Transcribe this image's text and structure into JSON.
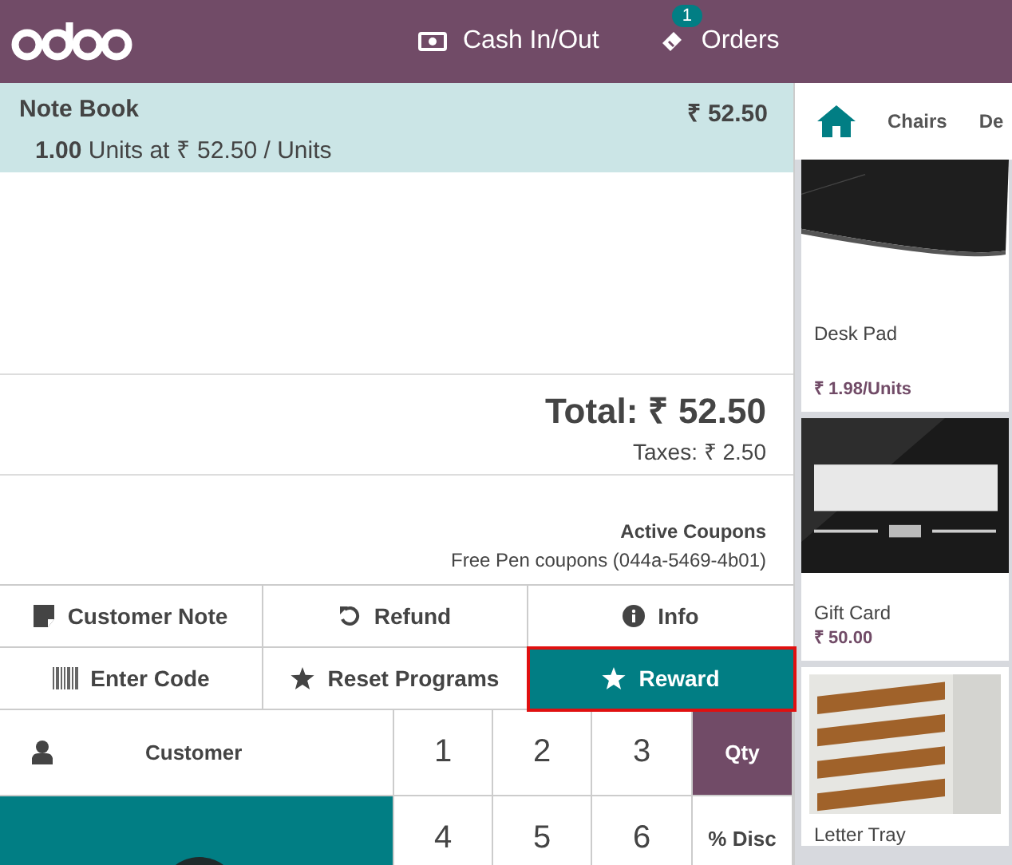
{
  "header": {
    "cash_button": "Cash In/Out",
    "orders_button": "Orders",
    "orders_badge": "1"
  },
  "order_line": {
    "name": "Note Book",
    "price": "₹ 52.50",
    "quantity": "1.00",
    "detail": "Units at ₹ 52.50 / Units",
    "selected": true
  },
  "totals": {
    "total": "Total: ₹ 52.50",
    "taxes": "Taxes: ₹ 2.50"
  },
  "coupons": {
    "title": "Active Coupons",
    "entry": "Free Pen coupons (044a-5469-4b01)"
  },
  "actions": [
    {
      "kind": "note",
      "label": "Customer Note",
      "selected": false,
      "highlighted": false
    },
    {
      "kind": "refund",
      "label": "Refund",
      "selected": false,
      "highlighted": false
    },
    {
      "kind": "info",
      "label": "Info",
      "selected": false,
      "highlighted": false
    },
    {
      "kind": "code",
      "label": "Enter Code",
      "selected": false,
      "highlighted": false
    },
    {
      "kind": "star",
      "label": "Reset Programs",
      "selected": false,
      "highlighted": false
    },
    {
      "kind": "star",
      "label": "Reward",
      "selected": true,
      "highlighted": true
    }
  ],
  "customer_button": "Customer",
  "numpad": [
    {
      "label": "1",
      "selected": false
    },
    {
      "label": "2",
      "selected": false
    },
    {
      "label": "3",
      "selected": false
    },
    {
      "label": "Qty",
      "selected": true
    },
    {
      "label": "4",
      "selected": false
    },
    {
      "label": "5",
      "selected": false
    },
    {
      "label": "6",
      "selected": false
    },
    {
      "label": "% Disc",
      "selected": false
    }
  ],
  "categories": [
    {
      "label": "Chairs"
    },
    {
      "label": "De"
    }
  ],
  "products": [
    {
      "name": "Desk Pad",
      "price": "₹ 1.98/Units"
    },
    {
      "name": "Gift Card",
      "price": "₹ 50.00"
    },
    {
      "name": "Letter Tray"
    }
  ]
}
